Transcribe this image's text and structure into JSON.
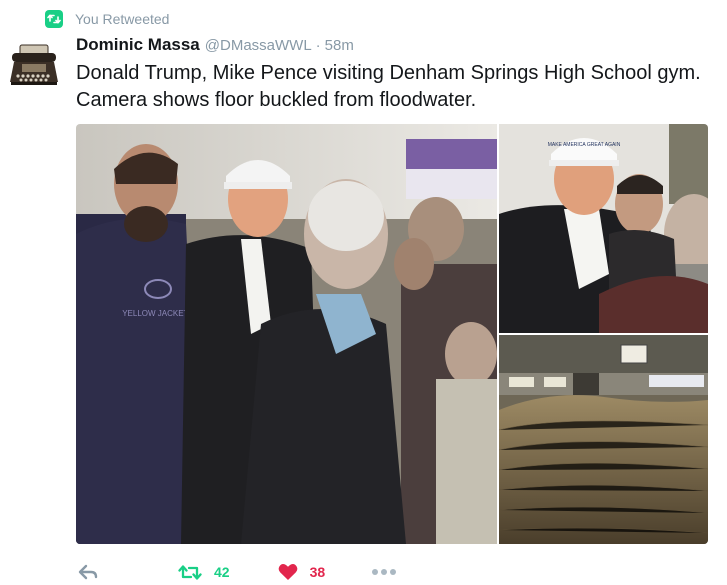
{
  "retweet_context": {
    "text": "You Retweeted",
    "icon": "retweet-icon",
    "color": "#19cf86"
  },
  "tweet": {
    "author_name": "Dominic Massa",
    "author_handle": "@DMassaWWL",
    "separator": "·",
    "time": "58m",
    "text_line1": "Donald Trump, Mike Pence visiting Denham Springs High School gym.",
    "text_line2": "Camera shows floor buckled from floodwater.",
    "avatar_icon": "typewriter-avatar"
  },
  "media": {
    "photos": [
      {
        "name": "photo-trump-pence-group",
        "shirt_text": "YELLOW JACKETS"
      },
      {
        "name": "photo-trump-closeup",
        "hat_text": "MAKE AMERICA GREAT AGAIN"
      },
      {
        "name": "photo-buckled-gym-floor"
      }
    ]
  },
  "actions": {
    "reply_icon": "reply-icon",
    "retweet_icon": "retweet-icon",
    "retweet_count": "42",
    "like_icon": "heart-icon",
    "like_count": "38",
    "more_icon": "more-icon"
  },
  "colors": {
    "retweet": "#19cf86",
    "like": "#e2264d",
    "muted": "#8899a6",
    "text": "#14171a"
  }
}
